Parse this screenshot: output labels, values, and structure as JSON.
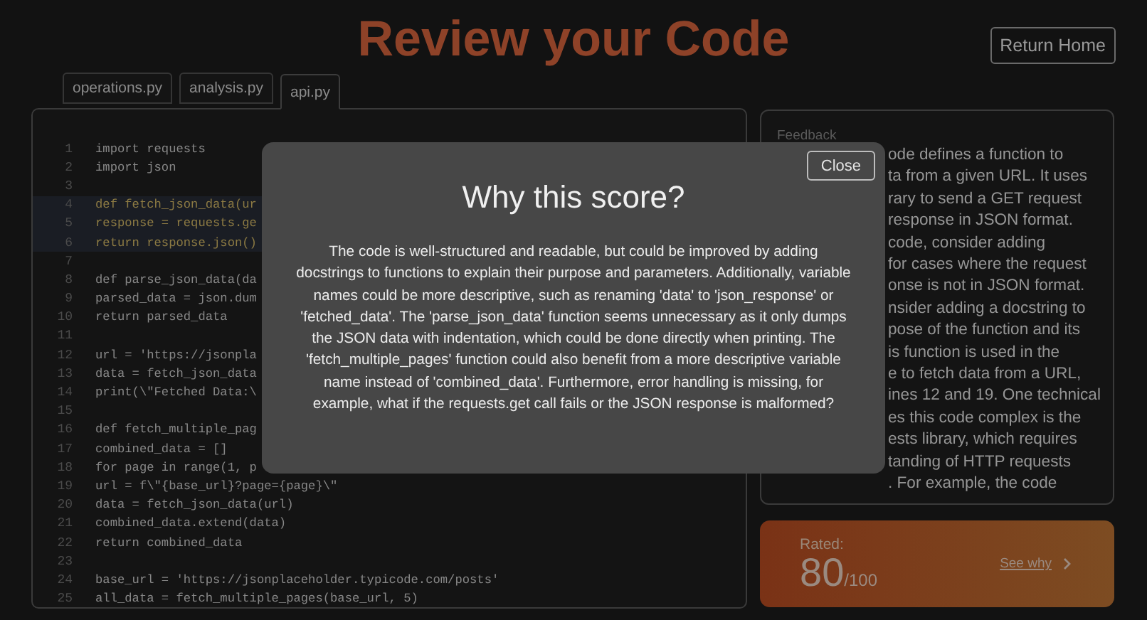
{
  "title": "Review your Code",
  "return_button": "Return Home",
  "tabs": [
    {
      "label": "operations.py",
      "selected": false
    },
    {
      "label": "analysis.py",
      "selected": false
    },
    {
      "label": "api.py",
      "selected": true
    }
  ],
  "code_lines": [
    {
      "number": "1",
      "text": "import requests",
      "highlighted": false
    },
    {
      "number": "2",
      "text": "import json",
      "highlighted": false
    },
    {
      "number": "3",
      "highlighted": false
    },
    {
      "number": "4",
      "text": "def fetch_json_data(ur",
      "highlighted": true
    },
    {
      "number": "5",
      "text": "response = requests.ge",
      "highlighted": true
    },
    {
      "number": "6",
      "text": "return response.json()",
      "highlighted": true
    },
    {
      "number": "7",
      "highlighted": false
    },
    {
      "number": "8",
      "text": "def parse_json_data(da",
      "highlighted": false
    },
    {
      "number": "9",
      "text": "parsed_data = json.dum",
      "highlighted": false
    },
    {
      "number": "10",
      "text": "return parsed_data",
      "highlighted": false
    },
    {
      "number": "11",
      "highlighted": false
    },
    {
      "number": "12",
      "text": "url = 'https://jsonpla",
      "highlighted": false
    },
    {
      "number": "13",
      "text": "data = fetch_json_data",
      "highlighted": false
    },
    {
      "number": "14",
      "text": "print(\\\"Fetched Data:\\",
      "highlighted": false
    },
    {
      "number": "15",
      "highlighted": false
    },
    {
      "number": "16",
      "text": "def fetch_multiple_pag",
      "highlighted": false
    },
    {
      "number": "17",
      "text": "combined_data = []",
      "highlighted": false
    },
    {
      "number": "18",
      "text": "for page in range(1, p",
      "highlighted": false
    },
    {
      "number": "19",
      "text": "url = f\\\"{base_url}?page={page}\\\"",
      "highlighted": false
    },
    {
      "number": "20",
      "text": "data = fetch_json_data(url)",
      "highlighted": false
    },
    {
      "number": "21",
      "text": "combined_data.extend(data)",
      "highlighted": false
    },
    {
      "number": "22",
      "text": "return combined_data",
      "highlighted": false
    },
    {
      "number": "23",
      "highlighted": false
    },
    {
      "number": "24",
      "text": "base_url = 'https://jsonplaceholder.typicode.com/posts'",
      "highlighted": false
    },
    {
      "number": "25",
      "text": "all_data = fetch_multiple_pages(base_url, 5)",
      "highlighted": false
    }
  ],
  "feedback": {
    "label": "Feedback",
    "lines": [
      "ode defines a function to",
      "ta from a given URL. It uses",
      "rary to send a GET request",
      "response in JSON format.",
      "code, consider adding",
      "for cases where the request",
      "onse is not in JSON format.",
      "nsider adding a docstring to",
      "pose of the function and its",
      "is function is used in the",
      "e to fetch data from a URL,",
      "ines 12 and 19. One technical",
      "es this code complex is the",
      "ests library, which requires",
      "tanding of HTTP requests",
      ". For example, the code"
    ]
  },
  "rating": {
    "label": "Rated:",
    "score": "80",
    "out_of": "/100",
    "link": "See why"
  },
  "modal": {
    "title": "Why this score?",
    "close": "Close",
    "body": "The code is well-structured and readable, but could be improved by adding docstrings to functions to explain their purpose and parameters. Additionally, variable names could be more descriptive, such as renaming 'data' to 'json_response' or 'fetched_data'. The 'parse_json_data' function seems unnecessary as it only dumps the JSON data with indentation, which could be done directly when printing. The 'fetch_multiple_pages' function could also benefit from a more descriptive variable name instead of 'combined_data'. Furthermore, error handling is missing, for example, what if the requests.get call fails or the JSON response is malformed?"
  }
}
